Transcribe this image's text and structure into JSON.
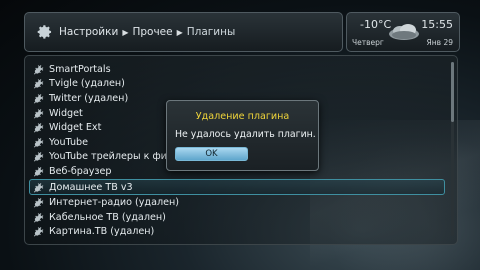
{
  "header": {
    "breadcrumb": [
      "Настройки",
      "Прочее",
      "Плагины"
    ]
  },
  "weather": {
    "temperature": "-10°C",
    "day": "Четверг",
    "time": "15:55",
    "date": "Янв 29",
    "icon": "cloud-icon"
  },
  "plugins": {
    "items": [
      {
        "label": "SmartPortals",
        "state": "normal"
      },
      {
        "label": "Tvigle (удален)",
        "state": "normal"
      },
      {
        "label": "Twitter (удален)",
        "state": "normal"
      },
      {
        "label": "Widget",
        "state": "normal"
      },
      {
        "label": "Widget Ext",
        "state": "normal"
      },
      {
        "label": "YouTube",
        "state": "normal"
      },
      {
        "label": "YouTube трейлеры к фил",
        "state": "normal"
      },
      {
        "label": "Веб-браузер",
        "state": "normal"
      },
      {
        "label": "Домашнее ТВ v3",
        "state": "selected"
      },
      {
        "label": "Интернет-радио (удален)",
        "state": "normal"
      },
      {
        "label": "Кабельное ТВ (удален)",
        "state": "normal"
      },
      {
        "label": "Картина.ТВ (удален)",
        "state": "normal"
      }
    ],
    "item_icon": "plug-icon"
  },
  "dialog": {
    "title": "Удаление плагина",
    "message": "Не удалось удалить плагин.",
    "ok_label": "OK"
  },
  "colors": {
    "dialog_title": "#f0d53a",
    "selection_border": "#3f8fa0",
    "ok_button": "#8cc6e4"
  }
}
